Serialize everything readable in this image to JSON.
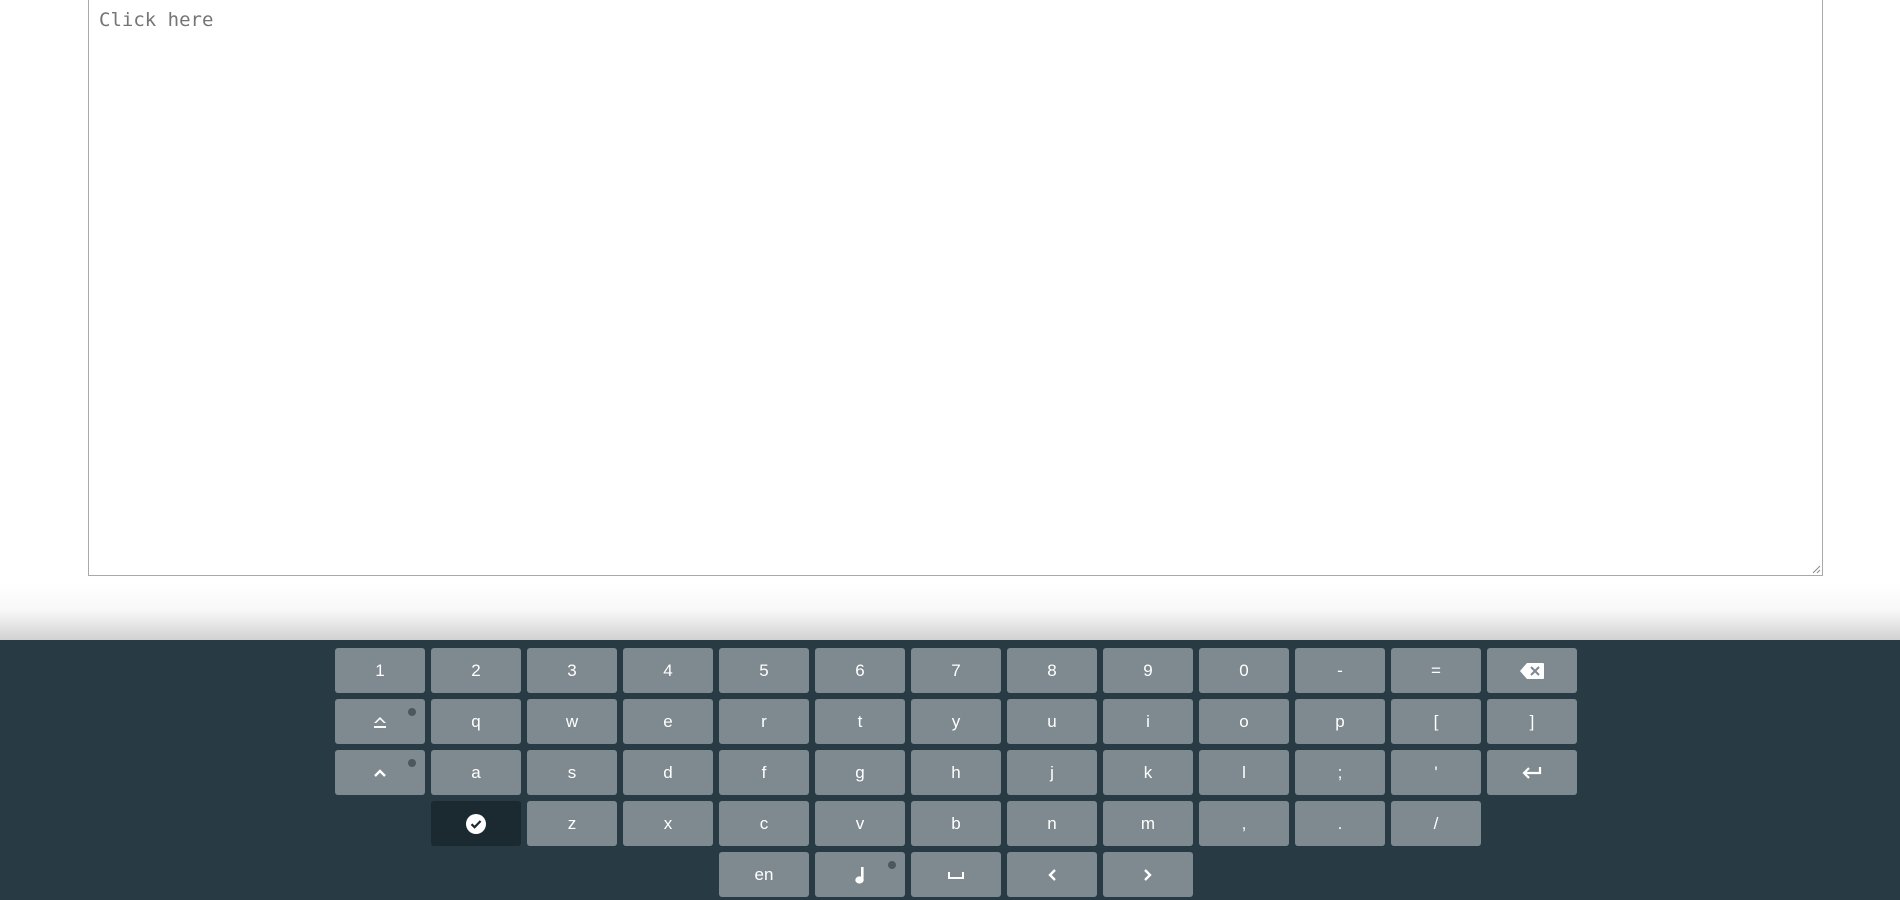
{
  "editor": {
    "placeholder": "Click here"
  },
  "keyboard": {
    "colors": {
      "background": "#283b45",
      "key": "#7e8a90",
      "key_dark": "#1b2a31",
      "key_text": "#ffffff"
    },
    "row1": {
      "k1": "1",
      "k2": "2",
      "k3": "3",
      "k4": "4",
      "k5": "5",
      "k6": "6",
      "k7": "7",
      "k8": "8",
      "k9": "9",
      "k0": "0",
      "minus": "-",
      "equals": "=",
      "backspace_icon": "backspace-icon"
    },
    "row2": {
      "shift_icon": "shift-lock-icon",
      "q": "q",
      "w": "w",
      "e": "e",
      "r": "r",
      "t": "t",
      "y": "y",
      "u": "u",
      "i": "i",
      "o": "o",
      "p": "p",
      "lbracket": "[",
      "rbracket": "]"
    },
    "row3": {
      "caps_icon": "caret-up-icon",
      "a": "a",
      "s": "s",
      "d": "d",
      "f": "f",
      "g": "g",
      "h": "h",
      "j": "j",
      "k": "k",
      "l": "l",
      "semicolon": ";",
      "quote": "'",
      "enter_icon": "enter-icon"
    },
    "row4": {
      "done_icon": "check-circle-icon",
      "z": "z",
      "x": "x",
      "c": "c",
      "v": "v",
      "b": "b",
      "n": "n",
      "m": "m",
      "comma": ",",
      "period": ".",
      "slash": "/"
    },
    "row5": {
      "language": "en",
      "music_icon": "music-note-icon",
      "space_icon": "space-icon",
      "left_icon": "chevron-left-icon",
      "right_icon": "chevron-right-icon"
    }
  }
}
